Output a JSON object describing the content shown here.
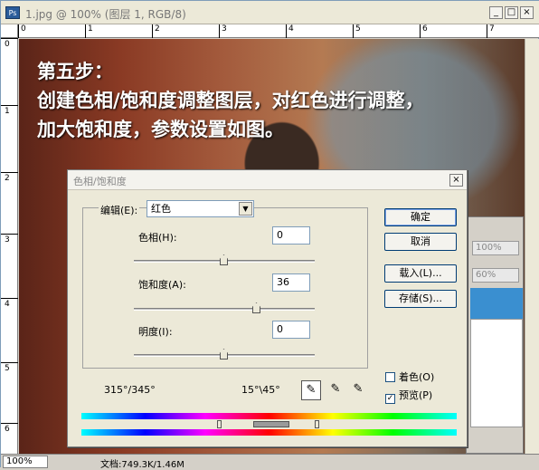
{
  "window": {
    "title": "1.jpg @ 100% (图层 1, RGB/8)",
    "app_icon": "Ps",
    "min_label": "_",
    "max_label": "□",
    "close_label": "×"
  },
  "rulers": {
    "h_ticks": [
      "0",
      "1",
      "2",
      "3",
      "4",
      "5",
      "6",
      "7"
    ],
    "v_ticks": [
      "0",
      "1",
      "2",
      "3",
      "4",
      "5",
      "6"
    ]
  },
  "canvas": {
    "heading": "第五步：",
    "line1": "创建色相/饱和度调整图层，对红色进行调整，",
    "line2": "加大饱和度，参数设置如图。"
  },
  "statusbar": {
    "zoom": "100%",
    "doc_info": "文档:749.3K/1.46M"
  },
  "layers_panel": {
    "opacity": "100%",
    "fill": "60%"
  },
  "dialog": {
    "title": "色相/饱和度",
    "close_label": "×",
    "edit_label": "编辑(E):",
    "edit_value": "红色",
    "hue_label": "色相(H):",
    "hue_value": "0",
    "saturation_label": "饱和度(A):",
    "saturation_value": "36",
    "lightness_label": "明度(I):",
    "lightness_value": "0",
    "ok_label": "确定",
    "cancel_label": "取消",
    "load_label": "载入(L)...",
    "save_label": "存储(S)...",
    "colorize_label": "着色(O)",
    "preview_label": "预览(P)",
    "colorize_checked": false,
    "preview_checked": true,
    "range_left": "315°/345°",
    "range_right": "15°\\45°",
    "hue_fraction": 0.5,
    "saturation_fraction": 0.68,
    "lightness_fraction": 0.5
  }
}
